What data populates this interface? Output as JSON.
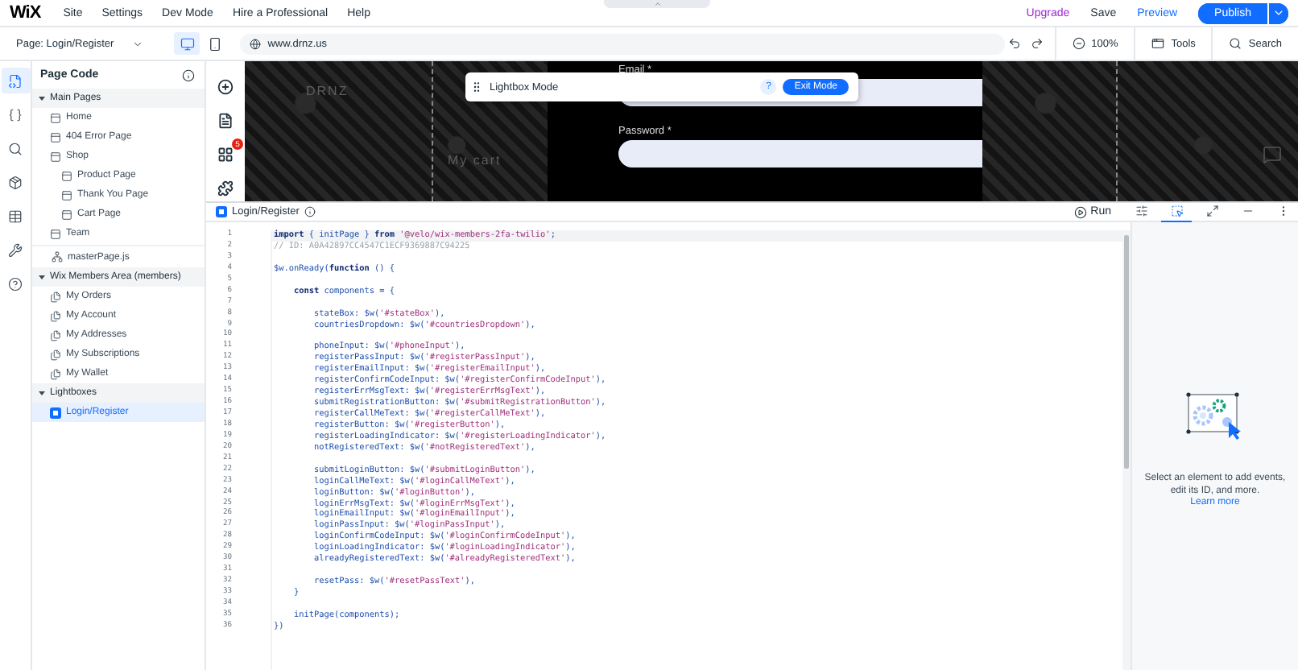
{
  "top_bar": {
    "logo": "WiX",
    "menu": [
      "Site",
      "Settings",
      "Dev Mode",
      "Hire a Professional",
      "Help"
    ],
    "upgrade": "Upgrade",
    "save": "Save",
    "preview": "Preview",
    "publish": "Publish"
  },
  "sub_bar": {
    "page": "Page: Login/Register",
    "devices": [
      {
        "kind": "desktop",
        "selected": true
      },
      {
        "kind": "mobile",
        "selected": false
      }
    ],
    "url": "www.drnz.us",
    "zoom": "100%",
    "tools": "Tools",
    "search": "Search"
  },
  "rail": [
    {
      "kind": "page-code",
      "selected": true
    },
    {
      "kind": "code",
      "selected": false
    },
    {
      "kind": "search",
      "selected": false
    },
    {
      "kind": "packages",
      "selected": false
    },
    {
      "kind": "database",
      "selected": false
    },
    {
      "kind": "dev-tools",
      "selected": false
    },
    {
      "kind": "help",
      "selected": false
    }
  ],
  "sidebar": {
    "title": "Page Code",
    "sections": [
      {
        "title": "Main Pages",
        "expanded": true,
        "items": [
          {
            "label": "Home",
            "kind": "page",
            "selected": false
          },
          {
            "label": "404 Error Page",
            "kind": "page",
            "selected": false
          },
          {
            "label": "Shop",
            "kind": "page",
            "selected": false,
            "children": [
              {
                "label": "Product Page",
                "kind": "page",
                "selected": false
              },
              {
                "label": "Thank You Page",
                "kind": "page",
                "selected": false
              },
              {
                "label": "Cart Page",
                "kind": "page",
                "selected": false
              }
            ]
          },
          {
            "label": "Team",
            "kind": "page",
            "selected": false
          }
        ],
        "file": "masterPage.js"
      },
      {
        "title": "Wix Members Area (members)",
        "expanded": true,
        "items": [
          {
            "label": "My Orders",
            "kind": "member",
            "selected": false
          },
          {
            "label": "My Account",
            "kind": "member",
            "selected": false
          },
          {
            "label": "My Addresses",
            "kind": "member",
            "selected": false
          },
          {
            "label": "My Subscriptions",
            "kind": "member",
            "selected": false
          },
          {
            "label": "My Wallet",
            "kind": "member",
            "selected": false
          }
        ]
      },
      {
        "title": "Lightboxes",
        "expanded": true,
        "items": [
          {
            "label": "Login/Register",
            "kind": "lightbox",
            "selected": true
          }
        ]
      }
    ]
  },
  "tools": [
    {
      "kind": "add"
    },
    {
      "kind": "pages"
    },
    {
      "kind": "apps",
      "badge": "5"
    },
    {
      "kind": "widgets"
    }
  ],
  "preview": {
    "logo": "DRNZ",
    "cart": "My cart",
    "fields": [
      {
        "label": "Email *"
      },
      {
        "label": "Password *"
      }
    ]
  },
  "lightbox_bar": {
    "title": "Lightbox Mode",
    "help": "?",
    "button": "Exit Mode"
  },
  "editor": {
    "tab": "Login/Register",
    "run": "Run",
    "actions": [
      {
        "kind": "properties",
        "selected": false
      },
      {
        "kind": "select",
        "selected": true
      },
      {
        "kind": "expand",
        "selected": false
      },
      {
        "kind": "minimize",
        "selected": false
      },
      {
        "kind": "more",
        "selected": false
      }
    ],
    "lines": [
      {
        "n": "1",
        "active": true,
        "tokens": [
          {
            "kind": "keyword",
            "text": "import"
          },
          {
            "kind": "code",
            "text": " { initPage } "
          },
          {
            "kind": "keyword",
            "text": "from"
          },
          {
            "kind": "string",
            "text": " '@velo/wix-members-2fa-twilio'"
          },
          {
            "kind": "code",
            "text": ";"
          }
        ]
      },
      {
        "n": "2",
        "active": false,
        "tokens": [
          {
            "kind": "comment",
            "text": "// ID: A0A42897CC4547C1ECF9369887C94225"
          }
        ]
      },
      {
        "n": "3",
        "active": false
      },
      {
        "n": "4",
        "active": false,
        "tokens": [
          {
            "kind": "code",
            "text": "$w.onReady("
          },
          {
            "kind": "keyword",
            "text": "function"
          },
          {
            "kind": "code",
            "text": " () {"
          }
        ]
      },
      {
        "n": "5",
        "active": false
      },
      {
        "n": "6",
        "active": false,
        "tokens": [
          {
            "kind": "keyword",
            "text": "    const"
          },
          {
            "kind": "code",
            "text": " components = {"
          }
        ]
      },
      {
        "n": "7",
        "active": false
      },
      {
        "n": "8",
        "active": false,
        "tokens": [
          {
            "kind": "code",
            "text": "        stateBox: $w("
          },
          {
            "kind": "string",
            "text": "'#stateBox'"
          },
          {
            "kind": "code",
            "text": "),"
          }
        ]
      },
      {
        "n": "9",
        "active": false,
        "tokens": [
          {
            "kind": "code",
            "text": "        countriesDropdown: $w("
          },
          {
            "kind": "string",
            "text": "'#countriesDropdown'"
          },
          {
            "kind": "code",
            "text": "),"
          }
        ]
      },
      {
        "n": "10",
        "active": false
      },
      {
        "n": "11",
        "active": false,
        "tokens": [
          {
            "kind": "code",
            "text": "        phoneInput: $w("
          },
          {
            "kind": "string",
            "text": "'#phoneInput'"
          },
          {
            "kind": "code",
            "text": "),"
          }
        ]
      },
      {
        "n": "12",
        "active": false,
        "tokens": [
          {
            "kind": "code",
            "text": "        registerPassInput: $w("
          },
          {
            "kind": "string",
            "text": "'#registerPassInput'"
          },
          {
            "kind": "code",
            "text": "),"
          }
        ]
      },
      {
        "n": "13",
        "active": false,
        "tokens": [
          {
            "kind": "code",
            "text": "        registerEmailInput: $w("
          },
          {
            "kind": "string",
            "text": "'#registerEmailInput'"
          },
          {
            "kind": "code",
            "text": "),"
          }
        ]
      },
      {
        "n": "14",
        "active": false,
        "tokens": [
          {
            "kind": "code",
            "text": "        registerConfirmCodeInput: $w("
          },
          {
            "kind": "string",
            "text": "'#registerConfirmCodeInput'"
          },
          {
            "kind": "code",
            "text": "),"
          }
        ]
      },
      {
        "n": "15",
        "active": false,
        "tokens": [
          {
            "kind": "code",
            "text": "        registerErrMsgText: $w("
          },
          {
            "kind": "string",
            "text": "'#registerErrMsgText'"
          },
          {
            "kind": "code",
            "text": "),"
          }
        ]
      },
      {
        "n": "16",
        "active": false,
        "tokens": [
          {
            "kind": "code",
            "text": "        submitRegistrationButton: $w("
          },
          {
            "kind": "string",
            "text": "'#submitRegistrationButton'"
          },
          {
            "kind": "code",
            "text": "),"
          }
        ]
      },
      {
        "n": "17",
        "active": false,
        "tokens": [
          {
            "kind": "code",
            "text": "        registerCallMeText: $w("
          },
          {
            "kind": "string",
            "text": "'#registerCallMeText'"
          },
          {
            "kind": "code",
            "text": "),"
          }
        ]
      },
      {
        "n": "18",
        "active": false,
        "tokens": [
          {
            "kind": "code",
            "text": "        registerButton: $w("
          },
          {
            "kind": "string",
            "text": "'#registerButton'"
          },
          {
            "kind": "code",
            "text": "),"
          }
        ]
      },
      {
        "n": "19",
        "active": false,
        "tokens": [
          {
            "kind": "code",
            "text": "        registerLoadingIndicator: $w("
          },
          {
            "kind": "string",
            "text": "'#registerLoadingIndicator'"
          },
          {
            "kind": "code",
            "text": "),"
          }
        ]
      },
      {
        "n": "20",
        "active": false,
        "tokens": [
          {
            "kind": "code",
            "text": "        notRegisteredText: $w("
          },
          {
            "kind": "string",
            "text": "'#notRegisteredText'"
          },
          {
            "kind": "code",
            "text": "),"
          }
        ]
      },
      {
        "n": "21",
        "active": false
      },
      {
        "n": "22",
        "active": false,
        "tokens": [
          {
            "kind": "code",
            "text": "        submitLoginButton: $w("
          },
          {
            "kind": "string",
            "text": "'#submitLoginButton'"
          },
          {
            "kind": "code",
            "text": "),"
          }
        ]
      },
      {
        "n": "23",
        "active": false,
        "tokens": [
          {
            "kind": "code",
            "text": "        loginCallMeText: $w("
          },
          {
            "kind": "string",
            "text": "'#loginCallMeText'"
          },
          {
            "kind": "code",
            "text": "),"
          }
        ]
      },
      {
        "n": "24",
        "active": false,
        "tokens": [
          {
            "kind": "code",
            "text": "        loginButton: $w("
          },
          {
            "kind": "string",
            "text": "'#loginButton'"
          },
          {
            "kind": "code",
            "text": "),"
          }
        ]
      },
      {
        "n": "25",
        "active": false,
        "tokens": [
          {
            "kind": "code",
            "text": "        loginErrMsgText: $w("
          },
          {
            "kind": "string",
            "text": "'#loginErrMsgText'"
          },
          {
            "kind": "code",
            "text": "),"
          }
        ]
      },
      {
        "n": "26",
        "active": false,
        "tokens": [
          {
            "kind": "code",
            "text": "        loginEmailInput: $w("
          },
          {
            "kind": "string",
            "text": "'#loginEmailInput'"
          },
          {
            "kind": "code",
            "text": "),"
          }
        ]
      },
      {
        "n": "27",
        "active": false,
        "tokens": [
          {
            "kind": "code",
            "text": "        loginPassInput: $w("
          },
          {
            "kind": "string",
            "text": "'#loginPassInput'"
          },
          {
            "kind": "code",
            "text": "),"
          }
        ]
      },
      {
        "n": "28",
        "active": false,
        "tokens": [
          {
            "kind": "code",
            "text": "        loginConfirmCodeInput: $w("
          },
          {
            "kind": "string",
            "text": "'#loginConfirmCodeInput'"
          },
          {
            "kind": "code",
            "text": "),"
          }
        ]
      },
      {
        "n": "29",
        "active": false,
        "tokens": [
          {
            "kind": "code",
            "text": "        loginLoadingIndicator: $w("
          },
          {
            "kind": "string",
            "text": "'#loginLoadingIndicator'"
          },
          {
            "kind": "code",
            "text": "),"
          }
        ]
      },
      {
        "n": "30",
        "active": false,
        "tokens": [
          {
            "kind": "code",
            "text": "        alreadyRegisteredText: $w("
          },
          {
            "kind": "string",
            "text": "'#alreadyRegisteredText'"
          },
          {
            "kind": "code",
            "text": "),"
          }
        ]
      },
      {
        "n": "31",
        "active": false
      },
      {
        "n": "32",
        "active": false,
        "tokens": [
          {
            "kind": "code",
            "text": "        resetPass: $w("
          },
          {
            "kind": "string",
            "text": "'#resetPassText'"
          },
          {
            "kind": "code",
            "text": "),"
          }
        ]
      },
      {
        "n": "33",
        "active": false,
        "tokens": [
          {
            "kind": "code",
            "text": "    }"
          }
        ]
      },
      {
        "n": "34",
        "active": false
      },
      {
        "n": "35",
        "active": false,
        "tokens": [
          {
            "kind": "code",
            "text": "    initPage(components);"
          }
        ]
      },
      {
        "n": "36",
        "active": false,
        "tokens": [
          {
            "kind": "code",
            "text": "})"
          }
        ]
      }
    ]
  },
  "properties_panel": {
    "message": "Select an element to add events, edit its ID, and more.",
    "link": "Learn more"
  }
}
